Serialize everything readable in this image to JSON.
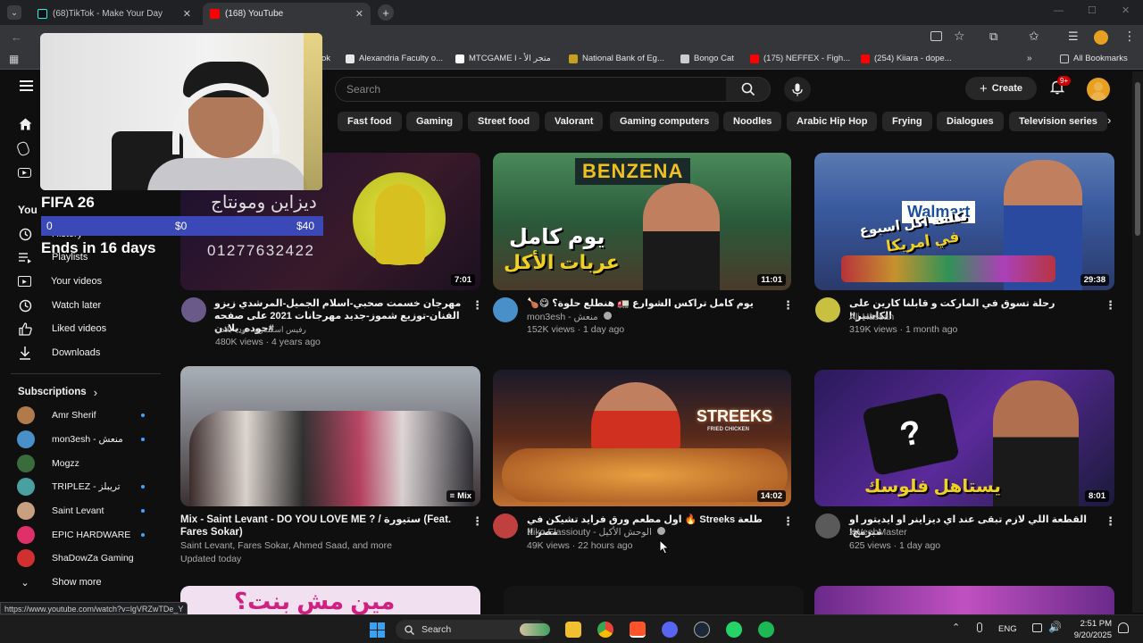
{
  "tabs": [
    {
      "title": "(68)TikTok - Make Your Day"
    },
    {
      "title": "(168) YouTube"
    }
  ],
  "bookmarks": [
    {
      "label": "ok"
    },
    {
      "label": "Alexandria Faculty o..."
    },
    {
      "label": "MTCGAME l - متجر الأ"
    },
    {
      "label": "National Bank of Eg..."
    },
    {
      "label": "Bongo Cat"
    },
    {
      "label": "(175) NEFFEX - Figh..."
    },
    {
      "label": "(254) Kiiara - dope..."
    }
  ],
  "all_bookmarks": "All Bookmarks",
  "search": {
    "placeholder": "Search"
  },
  "create_label": "Create",
  "notif_badge": "9+",
  "chips": [
    "Fast food",
    "Gaming",
    "Street food",
    "Valorant",
    "Gaming computers",
    "Noodles",
    "Arabic Hip Hop",
    "Frying",
    "Dialogues",
    "Television series"
  ],
  "sidebar": {
    "you_label": "You",
    "history": "History",
    "playlists": "Playlists",
    "your_videos": "Your videos",
    "watch_later": "Watch later",
    "liked_videos": "Liked videos",
    "downloads": "Downloads",
    "subscriptions_label": "Subscriptions",
    "subscriptions": [
      {
        "name": "Amr Sherif",
        "color": "#b07a4a"
      },
      {
        "name": "mon3esh - منعش",
        "color": "#4a90c8"
      },
      {
        "name": "Mogzz",
        "color": "#3a6b3a"
      },
      {
        "name": "TRIPLEZ - تريبلز",
        "color": "#4aa0a0"
      },
      {
        "name": "Saint Levant",
        "color": "#c8a080"
      },
      {
        "name": "EPIC HARDWARE",
        "color": "#e0306a"
      },
      {
        "name": "ShaDowZa Gaming",
        "color": "#d03030"
      }
    ],
    "show_more": "Show more"
  },
  "overlay": {
    "goal_title": "FIFA 26",
    "goal_start": "0",
    "goal_current": "$0",
    "goal_target": "$40",
    "goal_ends": "Ends in 16 days",
    "arabic_text": "ديزاين ومونتاج",
    "phone": "01277632422"
  },
  "videos": [
    {
      "title": "مهرجان خسمت صحبي-اسلام الجميل-المرشدي زيزو الفنان-توزيع شموز-جديد مهرجانات 2021 على صفحه #حوده_بلادن",
      "channel": "رفيس اسكندريه حوده بلادن",
      "meta": "480K views · 4 years ago",
      "duration": "7:01",
      "thumb_color": "#2a1e3a",
      "avatar_color": "#6a5a8a"
    },
    {
      "title": "يوم كامل تراكس الشوارع 🚛 هنطلع حلوة؟ 😋🍗",
      "channel": "mon3esh - منعش",
      "meta": "152K views · 1 day ago",
      "duration": "11:01",
      "thumb_color": "#3a6a4a",
      "avatar_color": "#4a90c8",
      "thumb_text_1": "يوم كامل",
      "thumb_text_2": "عربات الأكل",
      "sign": "BENZENA"
    },
    {
      "title": "رحلة تسوق في الماركت و قابلنا كارين على الكاشير!!",
      "channel": "Ali Hassan",
      "meta": "319K views · 1 month ago",
      "duration": "29:38",
      "thumb_color": "#3a5aa0",
      "avatar_color": "#c8c040",
      "thumb_text_1": "تكلفة اكل اسبوع",
      "thumb_text_2": "في امريكا",
      "sign": "Walmart"
    },
    {
      "title": "Mix - Saint Levant - DO YOU LOVE ME ? / ستيورة (Feat. Fares Sokar)",
      "channel": "Saint Levant, Fares Sokar, Ahmed Saad, and more",
      "meta": "Updated today",
      "duration": "Mix",
      "thumb_color": "#6a7a8a"
    },
    {
      "title": "طلعة Streeks 🔥 اول مطعم ورق فرايد تشيكن في مصر !!",
      "channel": "Kiko Elassiouty - الوحش الأكيل",
      "meta": "49K views · 22 hours ago",
      "duration": "14:02",
      "thumb_color": "#5a2a1a",
      "avatar_color": "#c04040",
      "sign": "STREEKS",
      "sign_sub": "FRIED CHICKEN"
    },
    {
      "title": "القطعة اللي لازم تبقى عند اي ديزاينر او ايديتور او مبرمج!",
      "channel": "xWeebMaster",
      "meta": "625 views · 1 day ago",
      "duration": "8:01",
      "thumb_color": "#3a2a6a",
      "avatar_color": "#5a5a5a",
      "thumb_text_1": "يستاهل فلوسك"
    }
  ],
  "row3": [
    {
      "thumb_text": "مين مش بنت؟",
      "thumb_color": "#f0e0f0"
    },
    {
      "thumb_color": "#151515"
    },
    {
      "thumb_color": "#8a3aa0"
    }
  ],
  "status_url": "https://www.youtube.com/watch?v=lgVRZwTDe_Y",
  "taskbar": {
    "search": "Search",
    "lang": "ENG",
    "time": "2:51 PM",
    "date": "9/20/2025"
  }
}
